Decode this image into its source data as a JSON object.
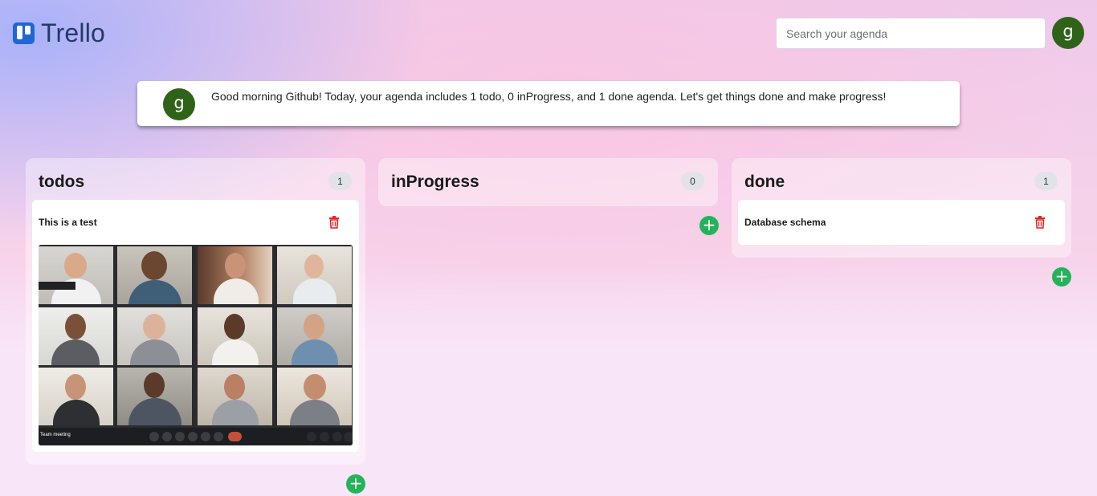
{
  "app": {
    "logo_text": "Trello",
    "search_placeholder": "Search your agenda",
    "user_initial": "g"
  },
  "greeting": {
    "text": "Good morning Github! Today, your agenda includes 1 todo, 0 inProgress, and 1 done agenda. Let's get things done and make progress!"
  },
  "columns": [
    {
      "title": "todos",
      "count": "1",
      "cards": [
        {
          "title": "This is a test",
          "image_caption": "Team meeting"
        }
      ]
    },
    {
      "title": "inProgress",
      "count": "0",
      "cards": []
    },
    {
      "title": "done",
      "count": "1",
      "cards": [
        {
          "title": "Database schema"
        }
      ]
    }
  ],
  "icons": {
    "add": "plus-icon",
    "delete": "trash-icon",
    "logo": "trello-logo-icon"
  },
  "colors": {
    "accent_green": "#23b359",
    "delete_red": "#e02424",
    "avatar_green": "#2f6319"
  }
}
